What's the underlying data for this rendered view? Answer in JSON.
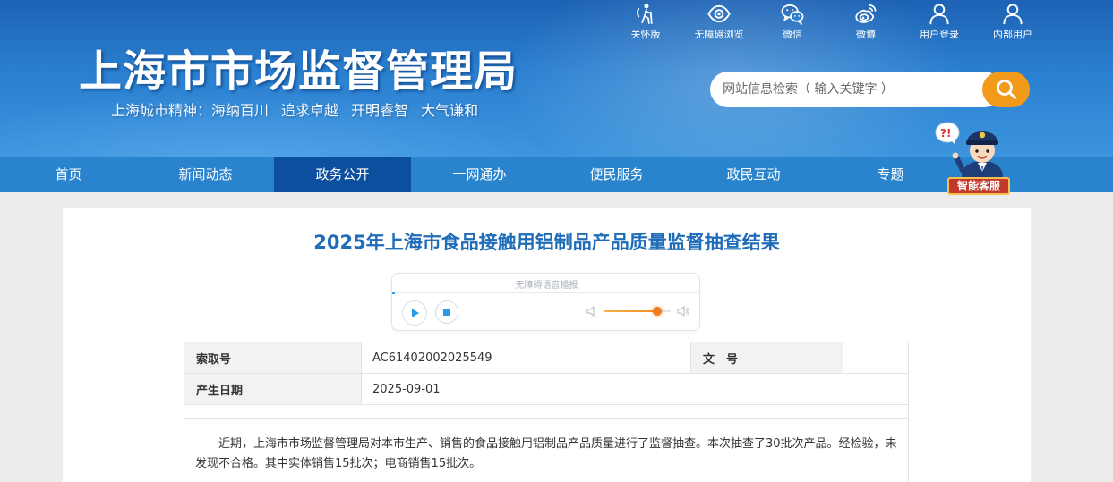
{
  "header": {
    "site_title": "上海市市场监督管理局",
    "slogan_prefix": "上海城市精神：",
    "slogan_items": [
      "海纳百川",
      "追求卓越",
      "开明睿智",
      "大气谦和"
    ]
  },
  "toplinks": [
    {
      "label": "关怀版",
      "icon": "elderly-care-icon"
    },
    {
      "label": "无障碍浏览",
      "icon": "eye-icon"
    },
    {
      "label": "微信",
      "icon": "wechat-icon"
    },
    {
      "label": "微博",
      "icon": "weibo-icon"
    },
    {
      "label": "用户登录",
      "icon": "user-icon"
    },
    {
      "label": "内部用户",
      "icon": "user-icon"
    }
  ],
  "search": {
    "placeholder": "网站信息检索（ 输入关键字 ）",
    "icon": "search-icon"
  },
  "nav": {
    "items": [
      "首页",
      "新闻动态",
      "政务公开",
      "一网通办",
      "便民服务",
      "政民互动",
      "专题"
    ],
    "active": "政务公开"
  },
  "assistant": {
    "label": "智能客服",
    "icon": "police-robot-icon"
  },
  "article": {
    "title": "2025年上海市食品接触用铝制品产品质量监督抽查结果",
    "audio": {
      "label": "无障碍语音播报",
      "volume_level": 0.8
    },
    "meta": {
      "index_label": "索取号",
      "index_value": "AC61402002025549",
      "doc_no_label": "文　号",
      "doc_no_value": "",
      "date_label": "产生日期",
      "date_value": "2025-09-01"
    },
    "body": "近期，上海市市场监督管理局对本市生产、销售的食品接触用铝制品产品质量进行了监督抽查。本次抽查了30批次产品。经检验，未发现不合格。其中实体销售15批次；电商销售15批次。"
  },
  "colors": {
    "header_blue": "#2a7fd0",
    "nav_blue": "#2a84cd",
    "nav_active": "#0d4f9f",
    "title_blue": "#1f6cb8",
    "search_orange": "#f29b1b",
    "volume_orange": "#f27b1d"
  }
}
